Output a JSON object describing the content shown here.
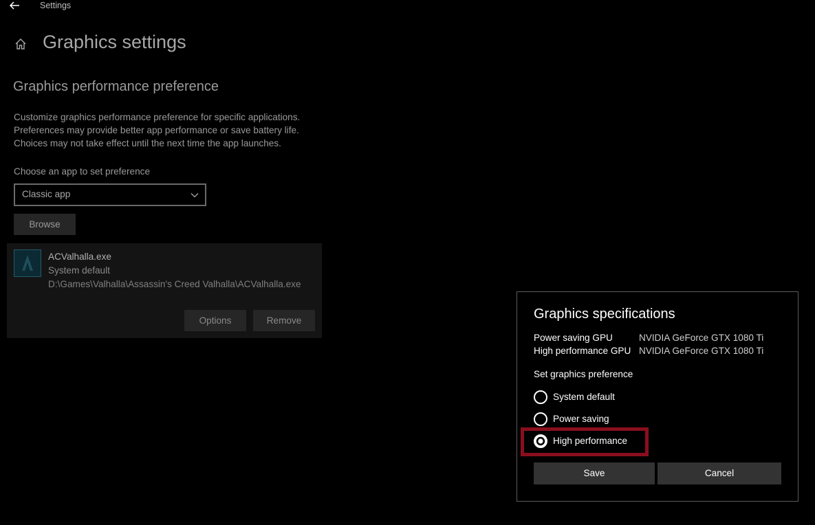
{
  "titlebar": {
    "title": "Settings"
  },
  "page": {
    "title": "Graphics settings"
  },
  "section": {
    "title": "Graphics performance preference",
    "description_lines": [
      "Customize graphics performance preference for specific applications.",
      "Preferences may provide better app performance or save battery life.",
      "Choices may not take effect until the next time the app launches."
    ],
    "choose_label": "Choose an app to set preference",
    "dropdown_value": "Classic app",
    "browse_label": "Browse"
  },
  "app": {
    "name": "ACValhalla.exe",
    "preference": "System default",
    "path": "D:\\Games\\Valhalla\\Assassin's Creed Valhalla\\ACValhalla.exe",
    "options_label": "Options",
    "remove_label": "Remove"
  },
  "dialog": {
    "title": "Graphics specifications",
    "specs": [
      {
        "label": "Power saving GPU",
        "value": "NVIDIA GeForce GTX 1080 Ti"
      },
      {
        "label": "High performance GPU",
        "value": "NVIDIA GeForce GTX 1080 Ti"
      }
    ],
    "set_pref_label": "Set graphics preference",
    "options": [
      {
        "label": "System default",
        "selected": false
      },
      {
        "label": "Power saving",
        "selected": false
      },
      {
        "label": "High performance",
        "selected": true
      }
    ],
    "save_label": "Save",
    "cancel_label": "Cancel"
  },
  "colors": {
    "highlight": "#8a0f1e",
    "background": "#000000"
  },
  "icons": {
    "back": "back-arrow-icon",
    "home": "home-icon",
    "chevron": "chevron-down-icon",
    "app": "assassins-creed-icon"
  }
}
